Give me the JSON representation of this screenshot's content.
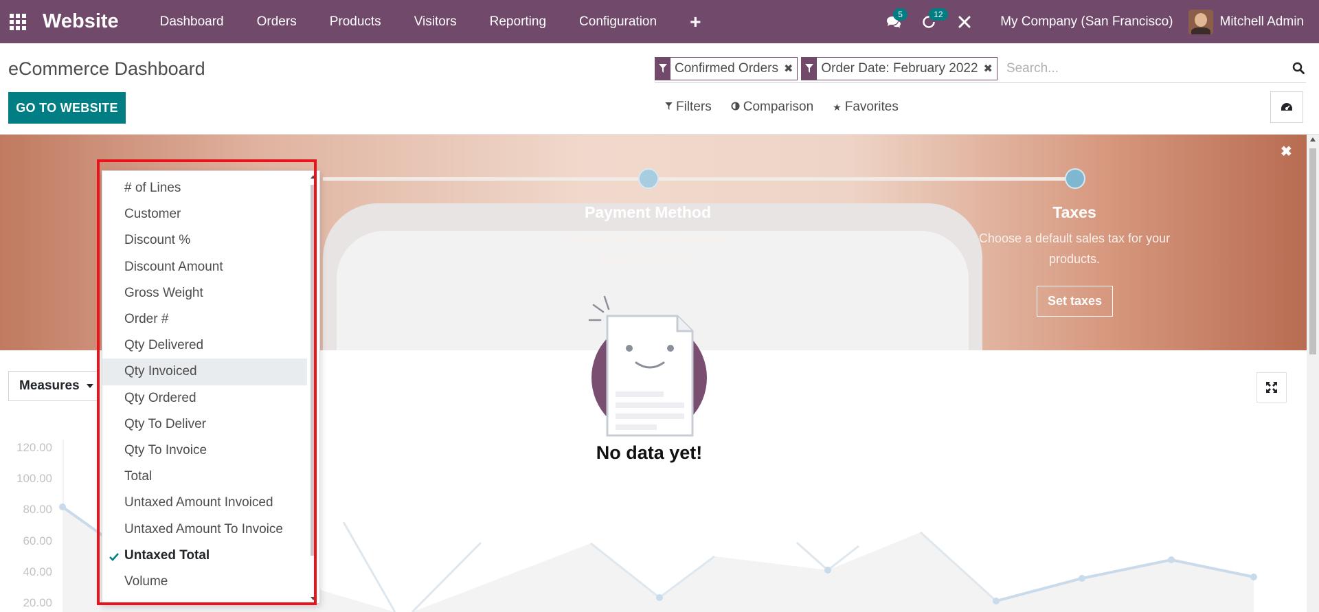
{
  "navbar": {
    "brand": "Website",
    "menu": [
      "Dashboard",
      "Orders",
      "Products",
      "Visitors",
      "Reporting",
      "Configuration"
    ],
    "messages_badge": "5",
    "activities_badge": "12",
    "company": "My Company (San Francisco)",
    "user": "Mitchell Admin"
  },
  "control_panel": {
    "title": "eCommerce Dashboard",
    "go_button": "GO TO WEBSITE",
    "facets": [
      "Confirmed Orders",
      "Order Date: February 2022"
    ],
    "search_placeholder": "Search...",
    "filters_label": "Filters",
    "comparison_label": "Comparison",
    "favorites_label": "Favorites"
  },
  "banner": {
    "steps": [
      {
        "title": "Payment Method",
        "description": "Choose your default customer payment method."
      },
      {
        "title": "Taxes",
        "description": "Choose a default sales tax for your products.",
        "button": "Set taxes"
      }
    ]
  },
  "graph": {
    "measures_label": "Measures",
    "no_data": "No data yet!",
    "y_ticks": [
      "120.00",
      "100.00",
      "80.00",
      "60.00",
      "40.00",
      "20.00"
    ]
  },
  "measures_menu": {
    "items": [
      {
        "label": "# of Lines",
        "selected": false
      },
      {
        "label": "Customer",
        "selected": false
      },
      {
        "label": "Discount %",
        "selected": false
      },
      {
        "label": "Discount Amount",
        "selected": false
      },
      {
        "label": "Gross Weight",
        "selected": false
      },
      {
        "label": "Order #",
        "selected": false
      },
      {
        "label": "Qty Delivered",
        "selected": false
      },
      {
        "label": "Qty Invoiced",
        "selected": false,
        "hover": true
      },
      {
        "label": "Qty Ordered",
        "selected": false
      },
      {
        "label": "Qty To Deliver",
        "selected": false
      },
      {
        "label": "Qty To Invoice",
        "selected": false
      },
      {
        "label": "Total",
        "selected": false
      },
      {
        "label": "Untaxed Amount Invoiced",
        "selected": false
      },
      {
        "label": "Untaxed Amount To Invoice",
        "selected": false
      },
      {
        "label": "Untaxed Total",
        "selected": true
      },
      {
        "label": "Volume",
        "selected": false
      }
    ]
  },
  "colors": {
    "brand": "#71496a",
    "accent": "#017e84",
    "highlight": "#e8131b"
  }
}
